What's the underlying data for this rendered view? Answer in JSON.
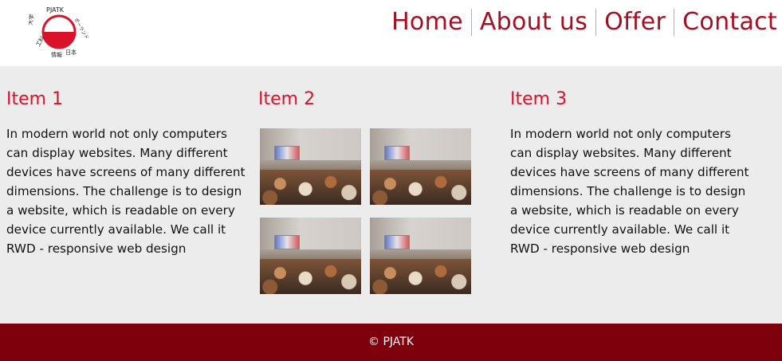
{
  "brand": {
    "logo_text": [
      "PJATK",
      "ポーランド",
      "日本",
      "情報",
      "工科",
      "大学"
    ],
    "accent": "#d9122a"
  },
  "nav": {
    "items": [
      "Home",
      "About us",
      "Offer",
      "Contact"
    ],
    "color": "#a60f22"
  },
  "columns": [
    {
      "title": "Item 1",
      "text": "In modern world not only computers can display websites. Many different devices have screens of many different dimensions. The challenge is to design a website, which is readable on every device currently available. We call it RWD - responsive web design"
    },
    {
      "title": "Item 2",
      "images": [
        "lecture-hall-photo",
        "lecture-hall-photo",
        "lecture-hall-photo",
        "lecture-hall-photo"
      ]
    },
    {
      "title": "Item 3",
      "text": "In modern world not only computers can display websites. Many different devices have screens of many different dimensions. The challenge is to design a website, which is readable on every device currently available. We call it RWD - responsive web design"
    }
  ],
  "footer": {
    "text": "© PJATK",
    "background": "#7e000c"
  }
}
